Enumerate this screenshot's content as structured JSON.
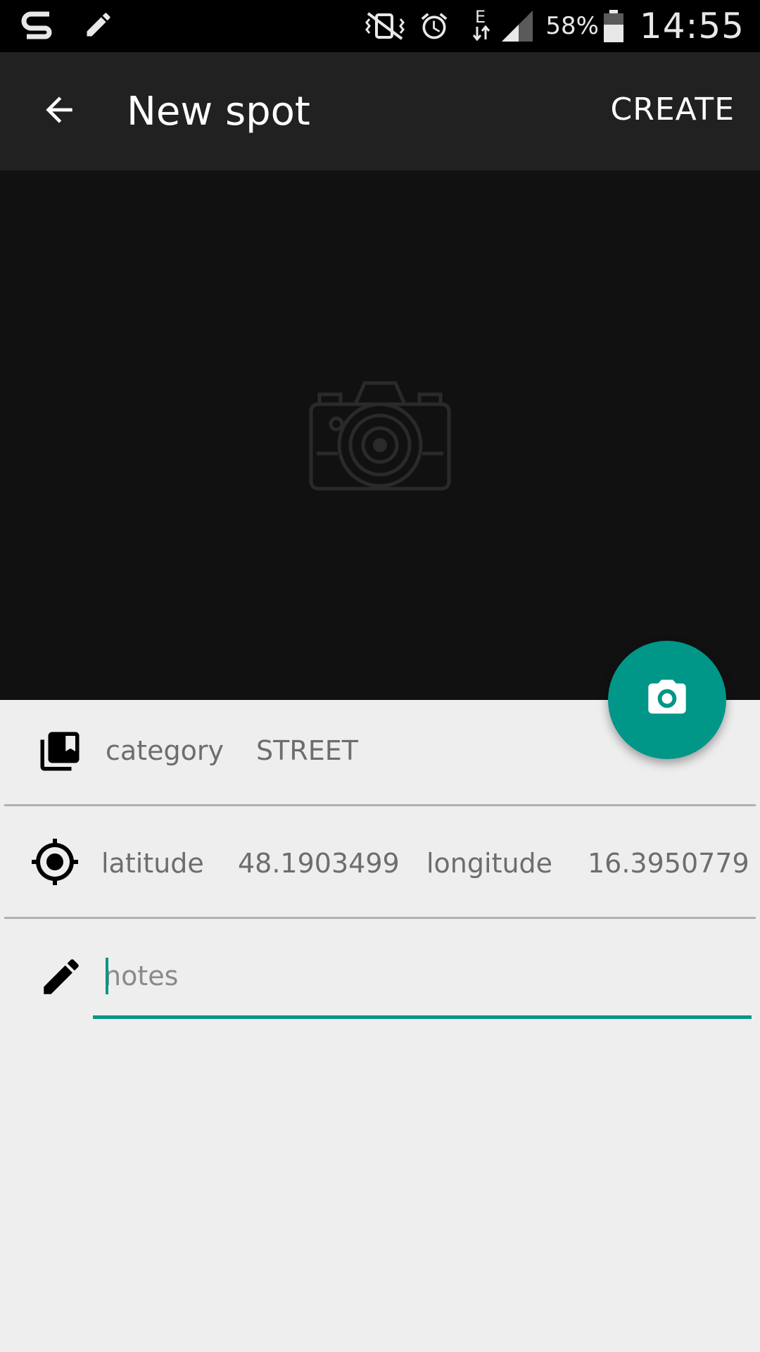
{
  "status_bar": {
    "battery_percent": "58%",
    "time": "14:55"
  },
  "app_bar": {
    "title": "New spot",
    "action_label": "CREATE"
  },
  "form": {
    "category": {
      "label": "category",
      "value": "STREET"
    },
    "location": {
      "latitude_label": "latitude",
      "latitude_value": "48.1903499",
      "longitude_label": "longitude",
      "longitude_value": "16.3950779"
    },
    "notes": {
      "placeholder": "notes",
      "value": ""
    }
  },
  "colors": {
    "accent": "#009688",
    "app_bar": "#212121",
    "photo_bg": "#111111",
    "content_bg": "#eeeeee"
  },
  "icons": {
    "back": "arrow-left-icon",
    "photo_placeholder": "camera-illustration-icon",
    "fab": "camera-icon",
    "category": "collections-bookmark-icon",
    "location": "gps-fixed-icon",
    "notes": "pencil-icon"
  }
}
